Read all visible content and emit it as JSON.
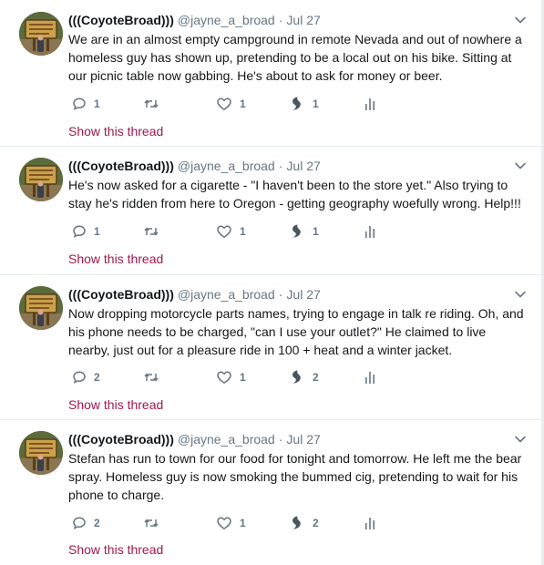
{
  "author": {
    "name": "(((CoyoteBroad)))",
    "handle": "@jayne_a_broad",
    "separator": "·"
  },
  "show_thread_label": "Show this thread",
  "tweets": [
    {
      "time": "Jul 27",
      "text": "We are in an almost empty campground in remote Nevada and out of nowhere a homeless guy has shown up, pretending to be a local out on his bike. Sitting at our picnic table now gabbing. He's about to ask for money or beer.",
      "replies": "1",
      "retweets": "",
      "likes": "1",
      "moments": "1"
    },
    {
      "time": "Jul 27",
      "text": "He's now asked for a cigarette - \"I haven't been to the store yet.\" Also trying to stay he's ridden from here to Oregon - getting geography woefully wrong. Help!!!",
      "replies": "1",
      "retweets": "",
      "likes": "1",
      "moments": "1"
    },
    {
      "time": "Jul 27",
      "text": "Now dropping motorcycle parts names, trying to engage in talk re riding. Oh, and his phone needs to be charged, \"can I use your outlet?\" He claimed to live nearby, just out for a pleasure ride in 100 + heat and a winter jacket.",
      "replies": "2",
      "retweets": "",
      "likes": "1",
      "moments": "2"
    },
    {
      "time": "Jul 27",
      "text": "Stefan has run to town for our food for tonight and tomorrow. He left me the bear spray. Homeless guy is now smoking the bummed cig, pretending to wait for his phone to charge.",
      "replies": "2",
      "retweets": "",
      "likes": "1",
      "moments": "2"
    }
  ],
  "icons": {
    "reply": "speech-bubble-icon",
    "retweet": "retweet-arrows-icon",
    "like": "heart-outline-icon",
    "moments": "swirl-icon",
    "analytics": "bar-chart-icon",
    "more": "chevron-down-icon"
  },
  "colors": {
    "link": "#a0184c",
    "text": "#14171a",
    "muted": "#657786",
    "border": "#e6ecf0"
  }
}
